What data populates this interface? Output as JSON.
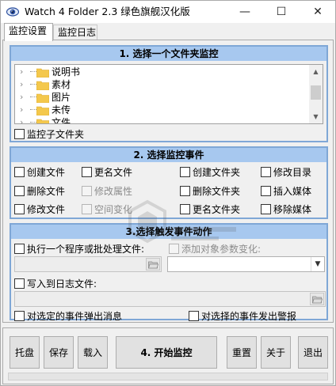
{
  "window": {
    "title": "Watch 4 Folder 2.3 绿色旗舰汉化版",
    "minimize_label": "—",
    "maximize_label": "☐",
    "close_label": "✕"
  },
  "tabs": [
    {
      "label": "监控设置",
      "active": true
    },
    {
      "label": "监控日志",
      "active": false
    }
  ],
  "section1": {
    "title": "1. 选择一个文件夹监控",
    "folders": [
      "说明书",
      "素材",
      "图片",
      "未传",
      "文件"
    ],
    "subfolders_label": "监控子文件夹"
  },
  "section2": {
    "title": "2. 选择监控事件",
    "events": [
      {
        "label": "创建文件",
        "enabled": true
      },
      {
        "label": "更名文件",
        "enabled": true
      },
      {
        "label": "创建文件夹",
        "enabled": true
      },
      {
        "label": "修改目录",
        "enabled": true
      },
      {
        "label": "删除文件",
        "enabled": true
      },
      {
        "label": "修改属性",
        "enabled": false
      },
      {
        "label": "删除文件夹",
        "enabled": true
      },
      {
        "label": "插入媒体",
        "enabled": true
      },
      {
        "label": "修改文件",
        "enabled": true
      },
      {
        "label": "空间变化",
        "enabled": false
      },
      {
        "label": "更名文件夹",
        "enabled": true
      },
      {
        "label": "移除媒体",
        "enabled": true
      }
    ]
  },
  "section3": {
    "title": "3.选择触发事件动作",
    "run_program_label": "执行一个程序或批处理文件:",
    "add_params_label": "添加对象参数变化:",
    "write_log_label": "写入到日志文件:",
    "popup_label": "对选定的事件弹出消息",
    "alarm_label": "对选择的事件发出警报"
  },
  "buttons": {
    "tray": "托盘",
    "save": "保存",
    "load": "载入",
    "start": "4. 开始监控",
    "reset": "重置",
    "about": "关于",
    "exit": "退出"
  },
  "colors": {
    "group_header": "#a7c8ef",
    "group_border": "#7fa7d6",
    "folder": "#f4c84c"
  }
}
